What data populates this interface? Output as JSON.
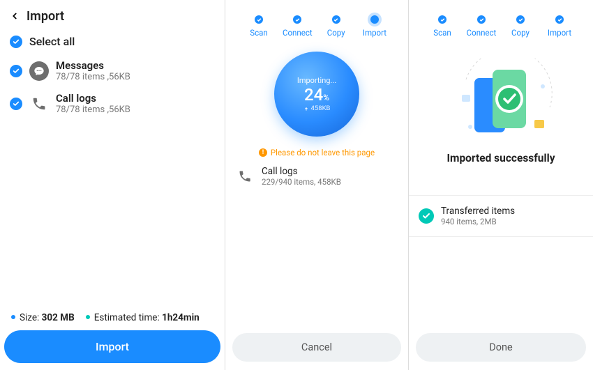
{
  "col1": {
    "title": "Import",
    "select_all": "Select all",
    "items": [
      {
        "title": "Messages",
        "subtitle": "78/78 items ,56KB"
      },
      {
        "title": "Call logs",
        "subtitle": "78/78 items ,56KB"
      }
    ],
    "size_label": "Size: ",
    "size_value": "302 MB",
    "eta_label": "Estimated time: ",
    "eta_value": "1h24min",
    "import_btn": "Import"
  },
  "steps": {
    "s1": "Scan",
    "s2": "Connect",
    "s3": "Copy",
    "s4": "Import"
  },
  "col2": {
    "importing_label": "Importing...",
    "percent": "24",
    "percent_suffix": "%",
    "size_done": "458KB",
    "warning": "Please do not leave this page",
    "current_title": "Call logs",
    "current_sub": "229/940 items, 458KB",
    "cancel_btn": "Cancel"
  },
  "col3": {
    "success": "Imported successfully",
    "transfer_title": "Transferred items",
    "transfer_sub": "940 items, 2MB",
    "done_btn": "Done"
  }
}
